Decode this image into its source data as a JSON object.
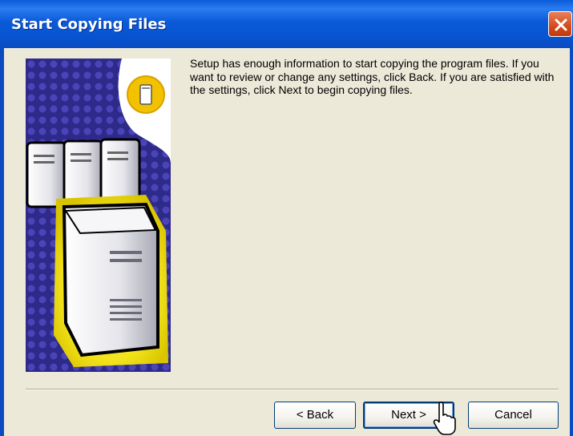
{
  "window": {
    "title": "Start Copying Files",
    "close_label": "✕"
  },
  "content": {
    "message": "Setup has enough information to start copying the program files. If you want to review or change any settings, click Back.  If you are satisfied with the settings, click Next to begin copying files."
  },
  "buttons": {
    "back": "< Back",
    "next": "Next >",
    "cancel": "Cancel"
  },
  "side_image": {
    "icon": "server-computers-illustration",
    "badge_icon": "computer-tower-icon"
  },
  "colors": {
    "titlebar": "#0a5bd9",
    "dialog_bg": "#ece9d8",
    "close_button": "#d44a1e",
    "illustration_purple": "#2e2a8a",
    "illustration_yellow": "#f2e21a"
  }
}
